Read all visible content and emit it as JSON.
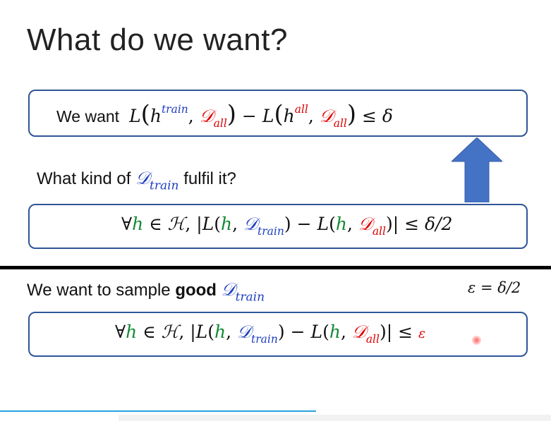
{
  "slide": {
    "title": "What do we want?",
    "box1": {
      "label": "We want",
      "L": "L",
      "h": "h",
      "train": "train",
      "all": "all",
      "D": "𝒟",
      "minus": "−",
      "leq": "≤",
      "delta": "δ"
    },
    "question": {
      "prefix": "What kind of",
      "D": "𝒟",
      "sub": "train",
      "suffix": "fulfil it?"
    },
    "box2": {
      "forall": "∀",
      "h": "h",
      "in": "∈",
      "H": "ℋ",
      "L": "L",
      "D": "𝒟",
      "train": "train",
      "all": "all",
      "minus": "−",
      "leq": "≤",
      "rhs": "δ/2"
    },
    "sample": {
      "prefix": "We want to sample",
      "bold": "good",
      "D": "𝒟",
      "sub": "train"
    },
    "epsilon_def": "ε = δ/2",
    "box3": {
      "forall": "∀",
      "h": "h",
      "in": "∈",
      "H": "ℋ",
      "L": "L",
      "D": "𝒟",
      "train": "train",
      "all": "all",
      "minus": "−",
      "leq": "≤",
      "rhs": "ε"
    }
  },
  "colors": {
    "box_border": "#2f5597",
    "arrow": "#4472c4",
    "red": "#e00000",
    "blue": "#1f3fbf",
    "green": "#138a36"
  }
}
